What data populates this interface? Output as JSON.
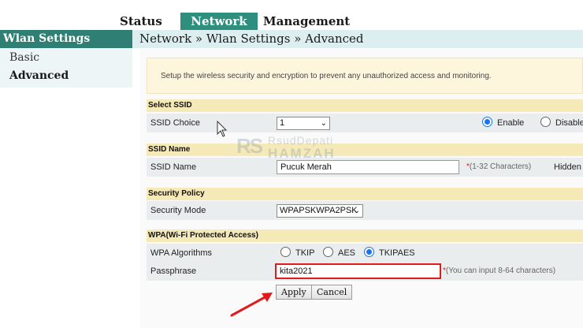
{
  "topnav": {
    "tabs": [
      {
        "label": "Status"
      },
      {
        "label": "Network"
      },
      {
        "label": "Management"
      }
    ],
    "active": "Network"
  },
  "sidebar": {
    "title": "Wlan Settings",
    "items": [
      {
        "label": "Basic"
      },
      {
        "label": "Advanced"
      }
    ],
    "selected": "Advanced"
  },
  "breadcrumb": "Network » Wlan Settings » Advanced",
  "intro": "Setup the wireless security and encryption to prevent any unauthorized access and monitoring.",
  "ssid_select": {
    "heading": "Select SSID",
    "label": "SSID Choice",
    "value": "1",
    "enable_label": "Enable",
    "disable_label": "Disable",
    "state": "Enable"
  },
  "ssid_name": {
    "heading": "SSID Name",
    "label": "SSID Name",
    "value": "Pucuk Merah",
    "required_mark": "*",
    "hint": "(1-32 Characters)",
    "hidden_label": "Hidden"
  },
  "security": {
    "heading": "Security Policy",
    "mode_label": "Security Mode",
    "mode_value": "WPAPSKWPA2PSK"
  },
  "wpa": {
    "heading": "WPA(Wi-Fi Protected Access)",
    "algorithms_label": "WPA Algorithms",
    "algorithms": [
      "TKIP",
      "AES",
      "TKIPAES"
    ],
    "selected_algorithm": "TKIPAES",
    "passphrase_label": "Passphrase",
    "passphrase_value": "kita2021",
    "required_mark": "*",
    "passphrase_hint": "(You can input 8-64 characters)"
  },
  "buttons": {
    "apply": "Apply",
    "cancel": "Cancel"
  },
  "watermark": {
    "logo": "RS",
    "line1": "RsudDepati",
    "line2": "HAMZAH"
  },
  "colors": {
    "accent": "#2f8f7f",
    "highlight": "#e01b1b",
    "radio_selected": "#1a73e8"
  }
}
